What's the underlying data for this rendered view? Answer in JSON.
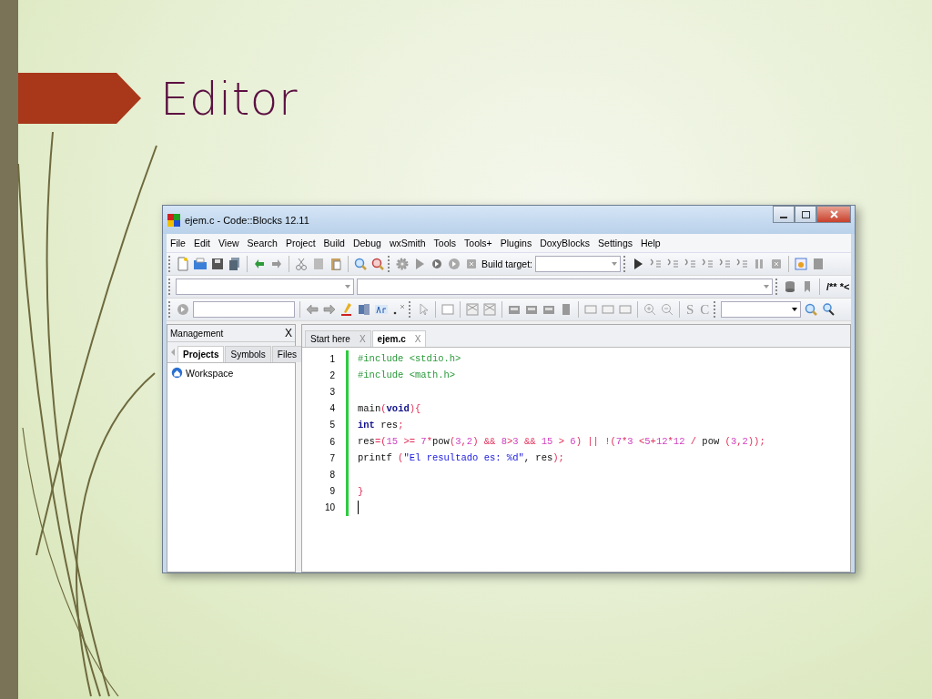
{
  "slide": {
    "title": "Editor"
  },
  "window": {
    "title": "ejem.c - Code::Blocks 12.11"
  },
  "menu": [
    "File",
    "Edit",
    "View",
    "Search",
    "Project",
    "Build",
    "Debug",
    "wxSmith",
    "Tools",
    "Tools+",
    "Plugins",
    "DoxyBlocks",
    "Settings",
    "Help"
  ],
  "toolbar": {
    "build_target_label": "Build target:",
    "comment_button": "/** *<",
    "letter_buttons": [
      "S",
      "C"
    ]
  },
  "management": {
    "title": "Management",
    "close": "X",
    "tabs": [
      {
        "label": "Projects",
        "selected": true
      },
      {
        "label": "Symbols",
        "selected": false
      },
      {
        "label": "Files",
        "selected": false
      }
    ],
    "tree": [
      {
        "label": "Workspace"
      }
    ]
  },
  "editor": {
    "tabs": [
      {
        "label": "Start here",
        "close": "X",
        "selected": false
      },
      {
        "label": "ejem.c",
        "close": "X",
        "selected": true
      }
    ],
    "lines": [
      {
        "number": "1",
        "cursor": false,
        "tokens": [
          {
            "text": "#include <stdio.h>",
            "kind": "preprocessor"
          }
        ]
      },
      {
        "number": "2",
        "cursor": false,
        "tokens": [
          {
            "text": "#include <math.h>",
            "kind": "preprocessor"
          }
        ]
      },
      {
        "number": "3",
        "cursor": false
      },
      {
        "number": "4",
        "cursor": false,
        "tokens": [
          {
            "text": "main",
            "kind": "plain"
          },
          {
            "text": "(",
            "kind": "operator"
          },
          {
            "text": "void",
            "kind": "keyword"
          },
          {
            "text": "){",
            "kind": "operator"
          }
        ]
      },
      {
        "number": "5",
        "cursor": false,
        "tokens": [
          {
            "text": "int",
            "kind": "keyword"
          },
          {
            "text": " res",
            "kind": "plain"
          },
          {
            "text": ";",
            "kind": "operator"
          }
        ]
      },
      {
        "number": "6",
        "cursor": false,
        "tokens": [
          {
            "text": "res",
            "kind": "plain"
          },
          {
            "text": "=(",
            "kind": "operator"
          },
          {
            "text": "15",
            "kind": "number"
          },
          {
            "text": " >= ",
            "kind": "operator"
          },
          {
            "text": "7",
            "kind": "number"
          },
          {
            "text": "*",
            "kind": "operator"
          },
          {
            "text": "pow",
            "kind": "plain"
          },
          {
            "text": "(",
            "kind": "operator"
          },
          {
            "text": "3",
            "kind": "number"
          },
          {
            "text": ",",
            "kind": "operator"
          },
          {
            "text": "2",
            "kind": "number"
          },
          {
            "text": ") && ",
            "kind": "operator"
          },
          {
            "text": "8",
            "kind": "number"
          },
          {
            "text": ">",
            "kind": "operator"
          },
          {
            "text": "3",
            "kind": "number"
          },
          {
            "text": " && ",
            "kind": "operator"
          },
          {
            "text": "15",
            "kind": "number"
          },
          {
            "text": " > ",
            "kind": "operator"
          },
          {
            "text": "6",
            "kind": "number"
          },
          {
            "text": ") || !(",
            "kind": "operator"
          },
          {
            "text": "7",
            "kind": "number"
          },
          {
            "text": "*",
            "kind": "operator"
          },
          {
            "text": "3",
            "kind": "number"
          },
          {
            "text": " <",
            "kind": "operator"
          },
          {
            "text": "5",
            "kind": "number"
          },
          {
            "text": "+",
            "kind": "operator"
          },
          {
            "text": "12",
            "kind": "number"
          },
          {
            "text": "*",
            "kind": "operator"
          },
          {
            "text": "12",
            "kind": "number"
          },
          {
            "text": " / ",
            "kind": "operator"
          },
          {
            "text": "pow ",
            "kind": "plain"
          },
          {
            "text": "(",
            "kind": "operator"
          },
          {
            "text": "3",
            "kind": "number"
          },
          {
            "text": ",",
            "kind": "operator"
          },
          {
            "text": "2",
            "kind": "number"
          },
          {
            "text": "));",
            "kind": "operator"
          }
        ]
      },
      {
        "number": "7",
        "cursor": false,
        "tokens": [
          {
            "text": "printf ",
            "kind": "plain"
          },
          {
            "text": "(",
            "kind": "operator"
          },
          {
            "text": "\"El resultado es: %d\"",
            "kind": "string"
          },
          {
            "text": ", res",
            "kind": "plain"
          },
          {
            "text": ");",
            "kind": "operator"
          }
        ]
      },
      {
        "number": "8",
        "cursor": false
      },
      {
        "number": "9",
        "cursor": false,
        "tokens": [
          {
            "text": "}",
            "kind": "operator"
          }
        ]
      },
      {
        "number": "10",
        "cursor": true
      }
    ]
  }
}
